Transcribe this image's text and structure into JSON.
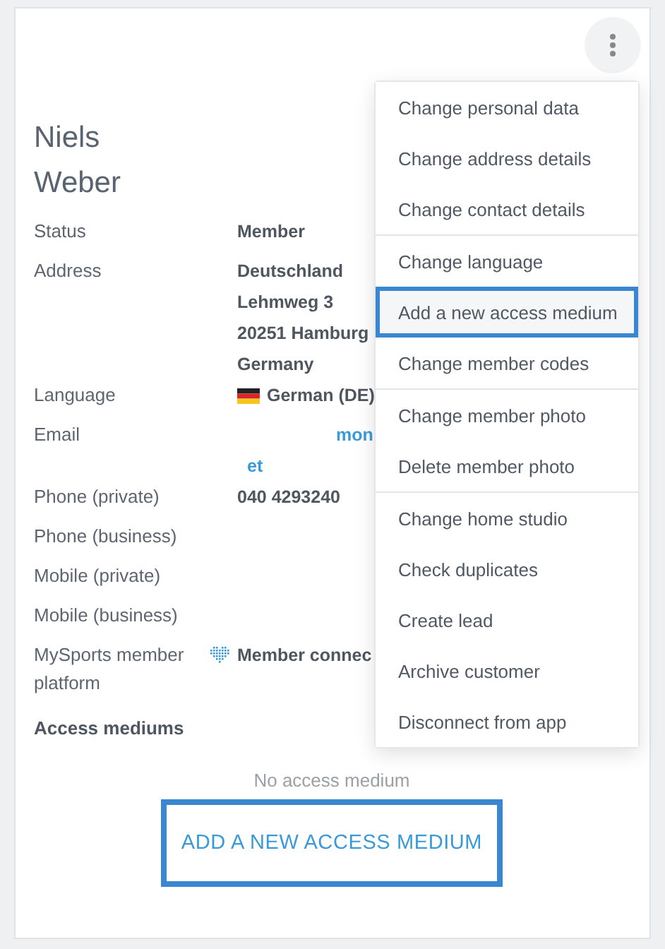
{
  "member": {
    "first_name": "Niels",
    "last_name": "Weber"
  },
  "fields": [
    {
      "label": "Status",
      "kind": "text",
      "lines": [
        "Member"
      ]
    },
    {
      "label": "Address",
      "kind": "text",
      "lines": [
        "Deutschland",
        "Lehmweg 3",
        "20251 Hamburg",
        "Germany"
      ]
    },
    {
      "label": "Language",
      "kind": "flag",
      "lines": [
        "German (DE)"
      ]
    },
    {
      "label": "Email",
      "kind": "link",
      "lines": [
        "mon",
        "et"
      ]
    },
    {
      "label": "Phone (private)",
      "kind": "text",
      "lines": [
        "040 4293240"
      ]
    },
    {
      "label": "Phone (business)"
    },
    {
      "label": "Mobile (private)"
    },
    {
      "label": "Mobile (business)"
    },
    {
      "label": "MySports member platform",
      "kind": "platform",
      "lines": [
        "Member connec"
      ]
    }
  ],
  "access_mediums": {
    "title": "Access mediums",
    "empty_text": "No access medium",
    "add_button": {
      "label": "ADD A NEW ACCESS MEDIUM",
      "highlighted": true
    }
  },
  "menu": {
    "groups": [
      [
        {
          "label": "Change personal data",
          "highlighted": false
        },
        {
          "label": "Change address details",
          "highlighted": false
        },
        {
          "label": "Change contact details",
          "highlighted": false
        }
      ],
      [
        {
          "label": "Change language",
          "highlighted": false
        },
        {
          "label": "Add a new access medium",
          "highlighted": true
        },
        {
          "label": "Change member codes",
          "highlighted": false
        }
      ],
      [
        {
          "label": "Change member photo",
          "highlighted": false
        },
        {
          "label": "Delete member photo",
          "highlighted": false
        }
      ],
      [
        {
          "label": "Change home studio",
          "highlighted": false
        },
        {
          "label": "Check duplicates",
          "highlighted": false
        },
        {
          "label": "Create lead",
          "highlighted": false
        },
        {
          "label": "Archive customer",
          "highlighted": false
        },
        {
          "label": "Disconnect from app",
          "highlighted": false
        }
      ]
    ]
  }
}
